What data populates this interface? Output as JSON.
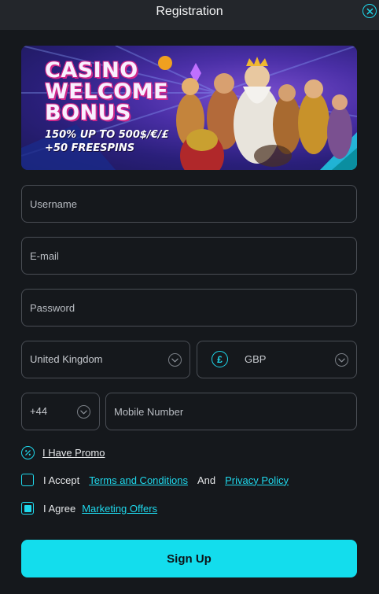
{
  "header": {
    "title": "Registration",
    "close_icon": "close-icon"
  },
  "banner": {
    "lines": [
      "CASINO",
      "WELCOME",
      "BONUS"
    ],
    "offer": "150% UP TO 500$/€/£",
    "freespins": "+50 FREESPINS"
  },
  "form": {
    "username_placeholder": "Username",
    "email_placeholder": "E-mail",
    "password_placeholder": "Password",
    "country": "United Kingdom",
    "currency_symbol": "£",
    "currency": "GBP",
    "phone_code": "+44",
    "mobile_placeholder": "Mobile Number"
  },
  "promo": {
    "label": "I Have Promo"
  },
  "terms": {
    "accept_label": "I Accept",
    "terms_link": "Terms and Conditions",
    "and": "And",
    "privacy_link": "Privacy Policy",
    "checked": false
  },
  "marketing": {
    "agree_label": "I Agree",
    "offers_link": "Marketing Offers",
    "checked": true
  },
  "signup_label": "Sign Up",
  "colors": {
    "accent": "#13dded",
    "background": "#15181c",
    "header": "#23262b",
    "border": "#4a4e55"
  }
}
